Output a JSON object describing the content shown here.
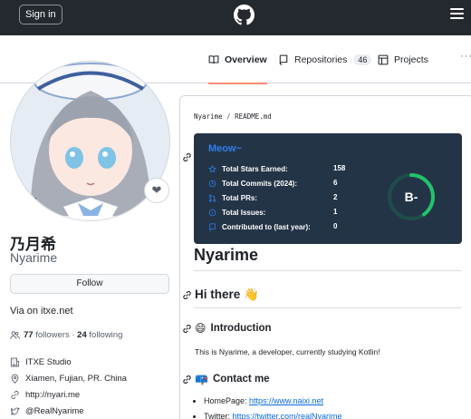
{
  "header": {
    "sign_in_label": "Sign in",
    "logo_icon": "github-mark-icon",
    "menu_icon": "hamburger-menu-icon"
  },
  "tabs": [
    {
      "label": "Overview",
      "icon": "book-icon",
      "selected": true
    },
    {
      "label": "Repositories",
      "icon": "repo-icon",
      "count": "46"
    },
    {
      "label": "Projects",
      "icon": "table-icon"
    }
  ],
  "profile": {
    "full_name": "乃月希",
    "login": "Nyarime",
    "follow_label": "Follow",
    "bio": "Via on itxe.net",
    "followers_count": "77",
    "followers_label": "followers",
    "separator": "·",
    "following_count": "24",
    "following_label": "following",
    "details": [
      {
        "icon": "organization-icon",
        "text": "ITXE Studio"
      },
      {
        "icon": "location-icon",
        "text": "Xiamen, Fujian, PR. China"
      },
      {
        "icon": "link-icon",
        "text": "http://nyari.me"
      },
      {
        "icon": "twitter-icon",
        "text": "@RealNyarime"
      }
    ]
  },
  "readme": {
    "path_user": "Nyarime",
    "path_sep": "/",
    "path_file": "README.md",
    "stats_card": {
      "title": "Meow~",
      "rows": [
        {
          "icon": "star-icon",
          "label": "Total Stars Earned:",
          "value": "158"
        },
        {
          "icon": "history-icon",
          "label": "Total Commits (2024):",
          "value": "6"
        },
        {
          "icon": "pull-request-icon",
          "label": "Total PRs:",
          "value": "2"
        },
        {
          "icon": "issue-icon",
          "label": "Total Issues:",
          "value": "1"
        },
        {
          "icon": "repo-icon",
          "label": "Contributed to (last year):",
          "value": "0"
        }
      ],
      "grade": "B-",
      "grade_progress": 0.4,
      "title_color": "#2f80ed",
      "ring_color": "#21c36b",
      "background": "#243447"
    },
    "h1": "Nyarime",
    "h2": "Hi there",
    "h2_emoji": "👋",
    "intro_emoji": "😄",
    "intro_heading": "Introduction",
    "intro_text": "This is Nyarime, a developer, currently studying Kotlin!",
    "contact_emoji": "📪",
    "contact_heading": "Contact me",
    "contacts": [
      {
        "label": "HomePage: ",
        "link": "https://www.naixi.net"
      },
      {
        "label": "Twitter: ",
        "link": "https://twitter.com/realNyarime"
      }
    ]
  }
}
